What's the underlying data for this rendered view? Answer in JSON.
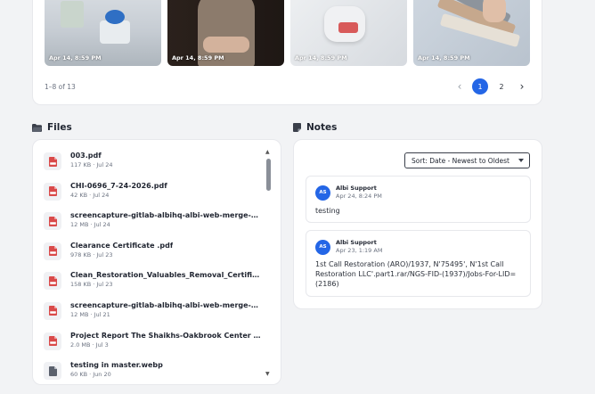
{
  "gallery": {
    "photos": [
      {
        "date": "Apr 14, 8:59 PM"
      },
      {
        "date": "Apr 14, 8:59 PM"
      },
      {
        "date": "Apr 14, 8:59 PM"
      },
      {
        "date": "Apr 14, 8:59 PM"
      }
    ],
    "range_text": "1–8 of 13",
    "pagination": {
      "prev": "‹",
      "pages": [
        "1",
        "2"
      ],
      "active_page": "1",
      "next": "›"
    }
  },
  "files": {
    "title": "Files",
    "icon": "folder-icon",
    "items": [
      {
        "name": "003.pdf",
        "meta": "117 KB · Jul 24",
        "type": "pdf"
      },
      {
        "name": "CHI-0696_7-24-2026.pdf",
        "meta": "42 KB · Jul 24",
        "type": "pdf"
      },
      {
        "name": "screencapture-gitlab-albihq-albi-web-merge-req...",
        "meta": "12 MB · Jul 24",
        "type": "pdf"
      },
      {
        "name": "Clearance Certificate .pdf",
        "meta": "978 KB · Jul 23",
        "type": "pdf"
      },
      {
        "name": "Clean_Restoration_Valuables_Removal_Certificat...",
        "meta": "158 KB · Jul 23",
        "type": "pdf"
      },
      {
        "name": "screencapture-gitlab-albihq-albi-web-merge-re.p...",
        "meta": "12 MB · Jul 21",
        "type": "pdf"
      },
      {
        "name": "Project Report The Shaikhs-Oakbrook Center Oak Br...",
        "meta": "2.0 MB · Jul 3",
        "type": "pdf"
      },
      {
        "name": "testing in master.webp",
        "meta": "60 KB · Jun 20",
        "type": "file"
      }
    ]
  },
  "notes": {
    "title": "Notes",
    "icon": "note-icon",
    "sort_label": "Sort: Date - Newest to Oldest",
    "items": [
      {
        "initials": "AS",
        "author": "Albi Support",
        "time": "Apr 24, 8:24 PM",
        "body": "testing"
      },
      {
        "initials": "AS",
        "author": "Albi Support",
        "time": "Apr 23, 1:19 AM",
        "body": "1st Call Restoration (ARO)/1937, N'75495', N'1st Call Restoration LLC'.part1.rar/NGS-FID-(1937)/Jobs-For-LID=(2186)"
      }
    ]
  },
  "colors": {
    "accent": "#2466e6",
    "pdf_icon": "#d94a4a",
    "page_bg": "#f2f3f5"
  }
}
